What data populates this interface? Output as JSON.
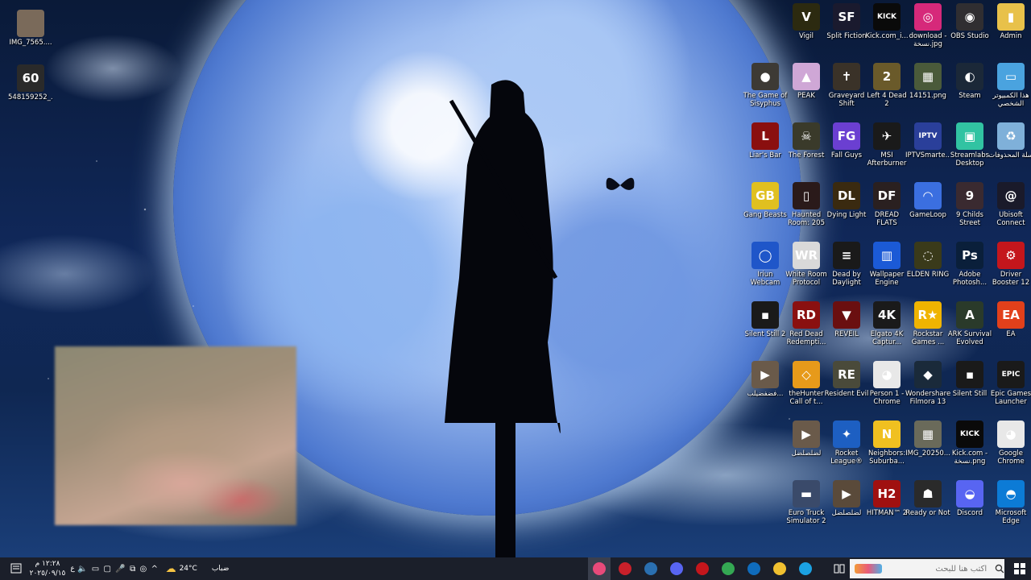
{
  "desktop": {
    "icons": [
      {
        "label": "IMG_7565....",
        "icon": "photo-icon",
        "color": "#7a6a5a"
      },
      {
        "label": "548159252_...",
        "icon": "image-file-icon",
        "color": "#2a2a2a",
        "glyph": "60"
      },
      {
        "label": "Vigil",
        "icon": "vigil-icon",
        "color": "#2c2a10",
        "glyph": "V"
      },
      {
        "label": "Split Fiction",
        "icon": "split-fiction-icon",
        "color": "#1a1a2e",
        "glyph": "SF"
      },
      {
        "label": "Kick.com_i...",
        "icon": "kick-icon",
        "color": "#0a0a0a",
        "glyph": "KICK"
      },
      {
        "label": "download - نسخة.jpg",
        "icon": "instagram-icon",
        "color": "#d6297a",
        "glyph": "◎"
      },
      {
        "label": "OBS Studio",
        "icon": "obs-icon",
        "color": "#302e31",
        "glyph": "◉"
      },
      {
        "label": "Admin",
        "icon": "folder-icon",
        "color": "#e8c14a",
        "glyph": "▮"
      },
      {
        "label": "The Game of Sisyphus",
        "icon": "sisyphus-icon",
        "color": "#3d3a35",
        "glyph": "●"
      },
      {
        "label": "PEAK",
        "icon": "peak-icon",
        "color": "#cfa7d6",
        "glyph": "▲"
      },
      {
        "label": "Graveyard Shift",
        "icon": "graveyard-icon",
        "color": "#3a3228",
        "glyph": "✝"
      },
      {
        "label": "Left 4 Dead 2",
        "icon": "l4d2-icon",
        "color": "#6a5a2a",
        "glyph": "2"
      },
      {
        "label": "14151.png",
        "icon": "png-file-icon",
        "color": "#4a5a3a",
        "glyph": "▦"
      },
      {
        "label": "Steam",
        "icon": "steam-icon",
        "color": "#1b2838",
        "glyph": "◐"
      },
      {
        "label": "هذا الكمبيوتر الشخصي",
        "icon": "this-pc-icon",
        "color": "#4aa3df",
        "glyph": "▭"
      },
      {
        "label": "Liar's Bar",
        "icon": "liars-bar-icon",
        "color": "#8a0f0f",
        "glyph": "L"
      },
      {
        "label": "The Forest",
        "icon": "the-forest-icon",
        "color": "#3a3a2a",
        "glyph": "☠"
      },
      {
        "label": "Fall Guys",
        "icon": "fall-guys-icon",
        "color": "#6b3fd1",
        "glyph": "FG"
      },
      {
        "label": "MSI Afterburner",
        "icon": "msi-afterburner-icon",
        "color": "#1a1a1a",
        "glyph": "✈"
      },
      {
        "label": "IPTVSmarte...",
        "icon": "iptv-icon",
        "color": "#2a3f9a",
        "glyph": "IPTV"
      },
      {
        "label": "Streamlabs Desktop",
        "icon": "streamlabs-icon",
        "color": "#31c3a2",
        "glyph": "▣"
      },
      {
        "label": "سلة المحذوفات",
        "icon": "recycle-bin-icon",
        "color": "#7fb0d9",
        "glyph": "♻"
      },
      {
        "label": "Gang Beasts",
        "icon": "gang-beasts-icon",
        "color": "#e0c020",
        "glyph": "GB"
      },
      {
        "label": "Haunted Room: 205",
        "icon": "haunted-room-icon",
        "color": "#2a1a1a",
        "glyph": "▯"
      },
      {
        "label": "Dying Light",
        "icon": "dying-light-icon",
        "color": "#3a2a10",
        "glyph": "DL"
      },
      {
        "label": "DREAD FLATS",
        "icon": "dread-flats-icon",
        "color": "#2a2020",
        "glyph": "DF"
      },
      {
        "label": "GameLoop",
        "icon": "gameloop-icon",
        "color": "#3b6fe0",
        "glyph": "◠"
      },
      {
        "label": "9 Childs Street",
        "icon": "9-childs-street-icon",
        "color": "#3a2a30",
        "glyph": "9"
      },
      {
        "label": "Ubisoft Connect",
        "icon": "ubisoft-icon",
        "color": "#1a1a2a",
        "glyph": "@"
      },
      {
        "label": "Iriun Webcam",
        "icon": "iriun-icon",
        "color": "#1f56c9",
        "glyph": "◯"
      },
      {
        "label": "White Room Protocol",
        "icon": "white-room-icon",
        "color": "#d9d9d9",
        "glyph": "WR"
      },
      {
        "label": "Dead by Daylight",
        "icon": "dbd-icon",
        "color": "#1a1a1a",
        "glyph": "≡"
      },
      {
        "label": "Wallpaper Engine",
        "icon": "wallpaper-engine-icon",
        "color": "#1b5ad6",
        "glyph": "▥"
      },
      {
        "label": "ELDEN RING",
        "icon": "elden-ring-icon",
        "color": "#3a3a1a",
        "glyph": "◌"
      },
      {
        "label": "Adobe Photosh...",
        "icon": "photoshop-icon",
        "color": "#0a1f3a",
        "glyph": "Ps"
      },
      {
        "label": "Driver Booster 12",
        "icon": "driver-booster-icon",
        "color": "#c4161c",
        "glyph": "⚙"
      },
      {
        "label": "Silent Still 2",
        "icon": "silent-still-2-icon",
        "color": "#1a1a1a",
        "glyph": "▪"
      },
      {
        "label": "Red Dead Redempti...",
        "icon": "rdr-icon",
        "color": "#8a1010",
        "glyph": "RD"
      },
      {
        "label": "REVEIL",
        "icon": "reveil-icon",
        "color": "#6a0f10",
        "glyph": "▼"
      },
      {
        "label": "Elgato 4K Captur...",
        "icon": "elgato-icon",
        "color": "#1a1a1a",
        "glyph": "4K"
      },
      {
        "label": "Rockstar Games ...",
        "icon": "rockstar-icon",
        "color": "#f0b400",
        "glyph": "R★"
      },
      {
        "label": "ARK Survival Evolved",
        "icon": "ark-icon",
        "color": "#2a3a2a",
        "glyph": "A"
      },
      {
        "label": "EA",
        "icon": "ea-icon",
        "color": "#e2401b",
        "glyph": "EA"
      },
      {
        "label": "فضفضيلب...",
        "icon": "video-file-icon",
        "color": "#6a5a4a",
        "glyph": "▶"
      },
      {
        "label": "theHunter Call of t...",
        "icon": "thehunter-icon",
        "color": "#e79a1a",
        "glyph": "◇"
      },
      {
        "label": "Resident Evil",
        "icon": "resident-evil-icon",
        "color": "#4a4a3a",
        "glyph": "RE"
      },
      {
        "label": "Person 1 - Chrome",
        "icon": "chrome-icon",
        "color": "#e8e8e8",
        "glyph": "◕"
      },
      {
        "label": "Wondershare Filmora 13",
        "icon": "filmora-icon",
        "color": "#1a2a3a",
        "glyph": "◆"
      },
      {
        "label": "Silent Still",
        "icon": "silent-still-icon",
        "color": "#1a1a1a",
        "glyph": "▪"
      },
      {
        "label": "Epic Games Launcher",
        "icon": "epic-games-icon",
        "color": "#1a1a1a",
        "glyph": "EPIC"
      },
      {
        "label": "لضلصلضل",
        "icon": "video-file-icon",
        "color": "#6a5a4a",
        "glyph": "▶"
      },
      {
        "label": "Rocket League®",
        "icon": "rocket-league-icon",
        "color": "#1d5fc2",
        "glyph": "✦"
      },
      {
        "label": "Neighbors: Suburba...",
        "icon": "neighbors-icon",
        "color": "#f0c020",
        "glyph": "N"
      },
      {
        "label": "IMG_20250...",
        "icon": "photo-icon",
        "color": "#6a6a5a",
        "glyph": "▦"
      },
      {
        "label": "Kick.com - نسخة.png",
        "icon": "kick-icon",
        "color": "#0a0a0a",
        "glyph": "KICK"
      },
      {
        "label": "Google Chrome",
        "icon": "chrome-icon",
        "color": "#e8e8e8",
        "glyph": "◕"
      },
      {
        "label": "Euro Truck Simulator 2",
        "icon": "ets2-icon",
        "color": "#3a4a6a",
        "glyph": "▬"
      },
      {
        "label": "لضلصلضل",
        "icon": "video-file-icon",
        "color": "#5a4a3a",
        "glyph": "▶"
      },
      {
        "label": "HITMAN™ 2",
        "icon": "hitman-icon",
        "color": "#a01010",
        "glyph": "H2"
      },
      {
        "label": "Ready or Not",
        "icon": "ready-or-not-icon",
        "color": "#2a2a2a",
        "glyph": "☗"
      },
      {
        "label": "Discord",
        "icon": "discord-icon",
        "color": "#5865f2",
        "glyph": "◒"
      },
      {
        "label": "Microsoft Edge",
        "icon": "edge-icon",
        "color": "#0c7bd6",
        "glyph": "◓"
      }
    ]
  },
  "taskbar": {
    "search_placeholder": "اكتب هنا للبحث",
    "weather": {
      "temp": "24°C",
      "condition": "ضباب"
    },
    "clock": {
      "time": "١٢:٢٨ م",
      "date": "٢٠٢٥/٠٩/١٥"
    },
    "language": "ع",
    "pinned_apps": [
      {
        "name": "browser-icon",
        "color": "#e84a7a"
      },
      {
        "name": "record-icon",
        "color": "#c8202a"
      },
      {
        "name": "steam-icon",
        "color": "#2a6fb0"
      },
      {
        "name": "discord-icon",
        "color": "#5865f2"
      },
      {
        "name": "driver-booster-icon",
        "color": "#c4161c"
      },
      {
        "name": "chrome-icon",
        "color": "#34a853"
      },
      {
        "name": "outlook-icon",
        "color": "#0f6cbd"
      },
      {
        "name": "store-icon",
        "color": "#f0c030"
      },
      {
        "name": "edge-icon",
        "color": "#1ba1e2"
      }
    ]
  }
}
